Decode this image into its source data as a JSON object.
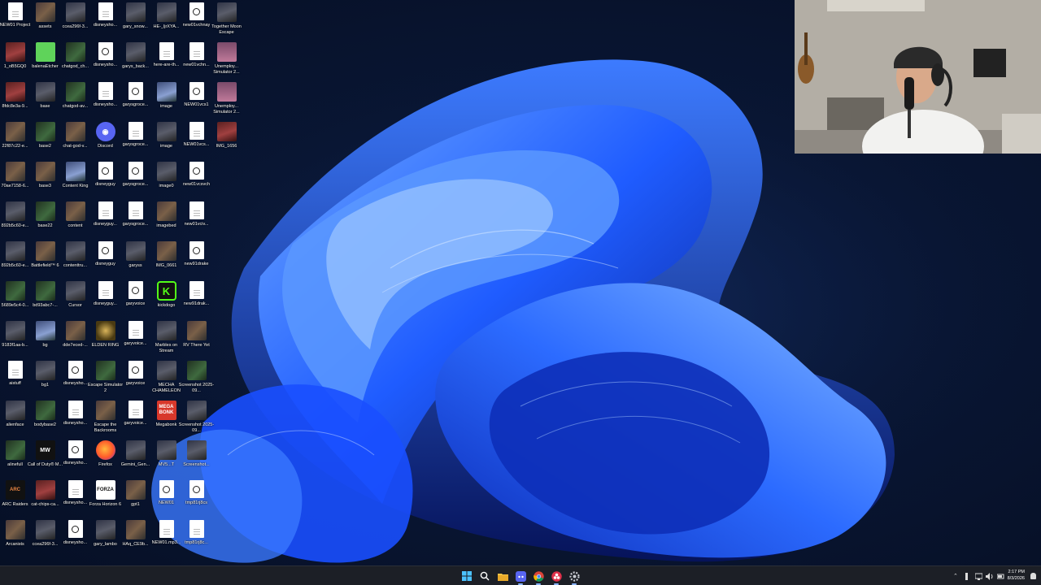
{
  "desktop": {
    "icons": [
      {
        "label": "NEW01 Project",
        "type": "doc"
      },
      {
        "label": "assets",
        "type": "img1"
      },
      {
        "label": "ccea296f-3...",
        "type": "img3"
      },
      {
        "label": "disneysho...",
        "type": "doc"
      },
      {
        "label": "gary_snow...",
        "type": "img3"
      },
      {
        "label": "HE-_ljrXYA...",
        "type": "img3"
      },
      {
        "label": "new01vchnay",
        "type": "vid"
      },
      {
        "label": "Together Moon Escape",
        "type": "img3"
      },
      {
        "label": "1_oB5GQ0",
        "type": "img5"
      },
      {
        "label": "balenaEtcher",
        "type": "green"
      },
      {
        "label": "chatgod_ch...",
        "type": "img2"
      },
      {
        "label": "disneysho...",
        "type": "vid"
      },
      {
        "label": "garys_back...",
        "type": "img3"
      },
      {
        "label": "here-are-th...",
        "type": "doc"
      },
      {
        "label": "new01vchn...",
        "type": "doc"
      },
      {
        "label": "Unemploy... Simulator 2...",
        "type": "people"
      },
      {
        "label": "8fdc8e3a-9...",
        "type": "img5"
      },
      {
        "label": "base",
        "type": "img3"
      },
      {
        "label": "chatgod-av...",
        "type": "img2"
      },
      {
        "label": "disneysho...",
        "type": "doc"
      },
      {
        "label": "garysgroce...",
        "type": "vid"
      },
      {
        "label": "image",
        "type": "img4"
      },
      {
        "label": "NEW01vcs1",
        "type": "vid"
      },
      {
        "label": "Unemploy... Simulator 2...",
        "type": "people"
      },
      {
        "label": "22f87c22-e...",
        "type": "img1"
      },
      {
        "label": "base2",
        "type": "img2"
      },
      {
        "label": "chat-god-v...",
        "type": "img1"
      },
      {
        "label": "Discord",
        "type": "discord"
      },
      {
        "label": "garysgroce...",
        "type": "doc"
      },
      {
        "label": "image",
        "type": "img3"
      },
      {
        "label": "NEW01vcs...",
        "type": "doc"
      },
      {
        "label": "IMG_1656",
        "type": "img5"
      },
      {
        "label": "70ae7158-6...",
        "type": "img1"
      },
      {
        "label": "base3",
        "type": "img1"
      },
      {
        "label": "Content King",
        "type": "img4"
      },
      {
        "label": "disneyguy",
        "type": "vid"
      },
      {
        "label": "garysgroce...",
        "type": "vid"
      },
      {
        "label": "image0",
        "type": "img3"
      },
      {
        "label": "new01vcsvch",
        "type": "vid"
      },
      {
        "label": "892b5c60-e...",
        "type": "img3"
      },
      {
        "label": "base22",
        "type": "img2"
      },
      {
        "label": "content",
        "type": "img1"
      },
      {
        "label": "disneyguy...",
        "type": "doc"
      },
      {
        "label": "garysgroce...",
        "type": "doc"
      },
      {
        "label": "imagebed",
        "type": "img1"
      },
      {
        "label": "new01vciv...",
        "type": "doc"
      },
      {
        "label": "892b5c60-e...",
        "type": "img3"
      },
      {
        "label": "Battlefield™ 6",
        "type": "img1"
      },
      {
        "label": "contenttru...",
        "type": "img3"
      },
      {
        "label": "disneyguy",
        "type": "vid"
      },
      {
        "label": "garyss",
        "type": "img3"
      },
      {
        "label": "IMG_0661",
        "type": "img1"
      },
      {
        "label": "new91drake",
        "type": "vid"
      },
      {
        "label": "5689e5c4-0...",
        "type": "img2"
      },
      {
        "label": "bd93abc7-...",
        "type": "img2"
      },
      {
        "label": "Cursor",
        "type": "img3"
      },
      {
        "label": "disneyguy...",
        "type": "doc"
      },
      {
        "label": "garyvoice",
        "type": "vid"
      },
      {
        "label": "kickdogo",
        "type": "kick"
      },
      {
        "label": "new91drak...",
        "type": "doc"
      },
      {
        "label": "9183f1aa-b...",
        "type": "img3"
      },
      {
        "label": "bg",
        "type": "img4"
      },
      {
        "label": "dde7eced-...",
        "type": "img1"
      },
      {
        "label": "ELDEN RING",
        "type": "elden"
      },
      {
        "label": "garyvoice...",
        "type": "doc"
      },
      {
        "label": "Marbles on Stream",
        "type": "img3"
      },
      {
        "label": "RV There Yet",
        "type": "img1"
      },
      {
        "label": "aistuff",
        "type": "doc"
      },
      {
        "label": "bg1",
        "type": "img3"
      },
      {
        "label": "disneysho...",
        "type": "vid"
      },
      {
        "label": "Escape Simulator 2",
        "type": "img2"
      },
      {
        "label": "garyvoice",
        "type": "vid"
      },
      {
        "label": "MECHA CHAMELEON",
        "type": "img3"
      },
      {
        "label": "Screenshot 2025-09...",
        "type": "img2"
      },
      {
        "label": "alienface",
        "type": "img3"
      },
      {
        "label": "bodybase2",
        "type": "img2"
      },
      {
        "label": "disneysho...",
        "type": "doc"
      },
      {
        "label": "Escape the Backrooms",
        "type": "img1"
      },
      {
        "label": "garyvoice...",
        "type": "doc"
      },
      {
        "label": "Megabonk",
        "type": "mega"
      },
      {
        "label": "Screenshot 2025-09...",
        "type": "img3"
      },
      {
        "label": "alinefull",
        "type": "img2"
      },
      {
        "label": "Call of Duty® M...",
        "type": "cod"
      },
      {
        "label": "disneysho...",
        "type": "vid"
      },
      {
        "label": "Firefox",
        "type": "firefox"
      },
      {
        "label": "Gemini_Gen...",
        "type": "img3"
      },
      {
        "label": "MV5...T",
        "type": "img3"
      },
      {
        "label": "Screenshot...",
        "type": "img3"
      },
      {
        "label": "ARC Raiders",
        "type": "arc"
      },
      {
        "label": "cat-chips-ca...",
        "type": "img5"
      },
      {
        "label": "disneysho...",
        "type": "doc"
      },
      {
        "label": "Forza Horizon 6",
        "type": "forza"
      },
      {
        "label": "gpt1",
        "type": "img1"
      },
      {
        "label": "NEW01",
        "type": "vid"
      },
      {
        "label": "tmp81rj8cs",
        "type": "vid"
      },
      {
        "label": "Arcanists",
        "type": "img1"
      },
      {
        "label": "ccea296f-3...",
        "type": "img3"
      },
      {
        "label": "disneysho...",
        "type": "vid"
      },
      {
        "label": "gary_lambo",
        "type": "img3"
      },
      {
        "label": "HAq_CE9b...",
        "type": "img1"
      },
      {
        "label": "NEW01.mp3...",
        "type": "doc"
      },
      {
        "label": "tmp81rj8c...",
        "type": "doc"
      }
    ]
  },
  "taskbar": {
    "apps": [
      "start-icon",
      "search-icon",
      "file-explorer-icon",
      "discord-icon",
      "chrome-icon",
      "obs-icon",
      "settings-icon"
    ],
    "clock_time": "2:17 PM",
    "clock_date": "8/3/2026"
  },
  "colors": {
    "taskbar_bg": "#1c1f26",
    "wallpaper_blue": "#1a4fff",
    "wallpaper_dark": "#071233"
  }
}
